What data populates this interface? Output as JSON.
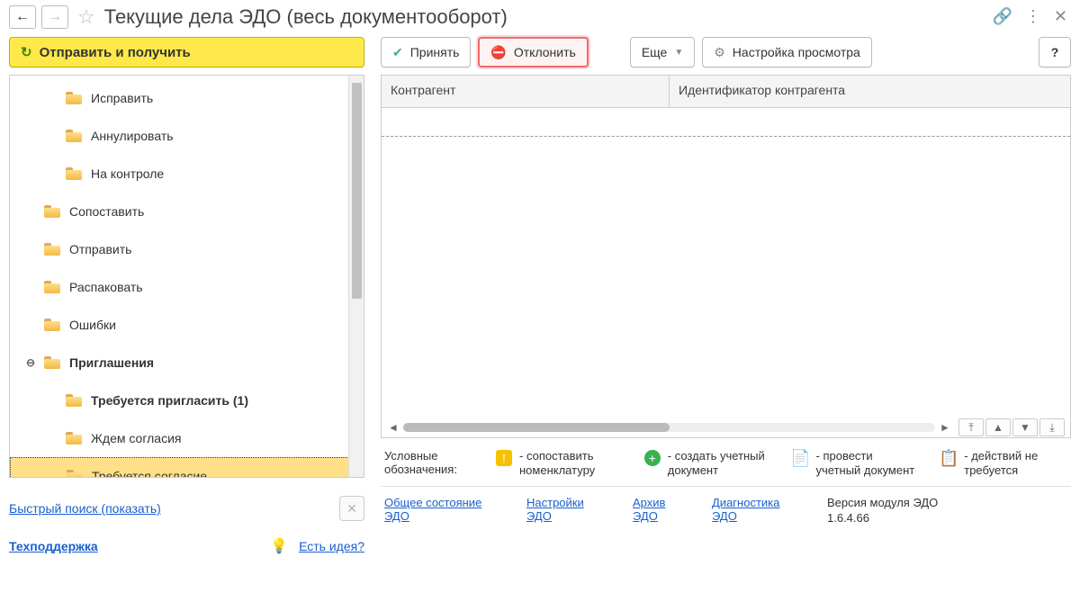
{
  "header": {
    "title": "Текущие дела ЭДО (весь документооборот)"
  },
  "left": {
    "send_receive": "Отправить и получить",
    "tree": [
      {
        "indent": 1,
        "label": "Исправить"
      },
      {
        "indent": 1,
        "label": "Аннулировать"
      },
      {
        "indent": 1,
        "label": "На контроле"
      },
      {
        "indent": 0,
        "label": "Сопоставить"
      },
      {
        "indent": 0,
        "label": "Отправить"
      },
      {
        "indent": 0,
        "label": "Распаковать"
      },
      {
        "indent": 0,
        "label": "Ошибки"
      },
      {
        "indent": 0,
        "label": "Приглашения",
        "bold": true,
        "expand": true
      },
      {
        "indent": 1,
        "label": "Требуется пригласить (1)",
        "bold": true
      },
      {
        "indent": 1,
        "label": "Ждем согласия"
      },
      {
        "indent": 1,
        "label": "Требуется согласие",
        "selected": true
      }
    ],
    "quick_search": "Быстрый поиск (показать)",
    "support": "Техподдержка",
    "idea": "Есть идея?"
  },
  "toolbar": {
    "accept": "Принять",
    "reject": "Отклонить",
    "more": "Еще",
    "view": "Настройка просмотра",
    "help": "?"
  },
  "grid": {
    "col1": "Контрагент",
    "col2": "Идентификатор контрагента"
  },
  "legend": {
    "label": "Условные обозначения:",
    "items": [
      "- сопоставить номенклатуру",
      "- создать учетный документ",
      "- провести учетный документ",
      "- действий не требуется"
    ]
  },
  "footer": {
    "links": [
      "Общее состояние ЭДО",
      "Настройки ЭДО",
      "Архив ЭДО",
      "Диагностика ЭДО"
    ],
    "version_label": "Версия модуля ЭДО",
    "version": "1.6.4.66"
  }
}
